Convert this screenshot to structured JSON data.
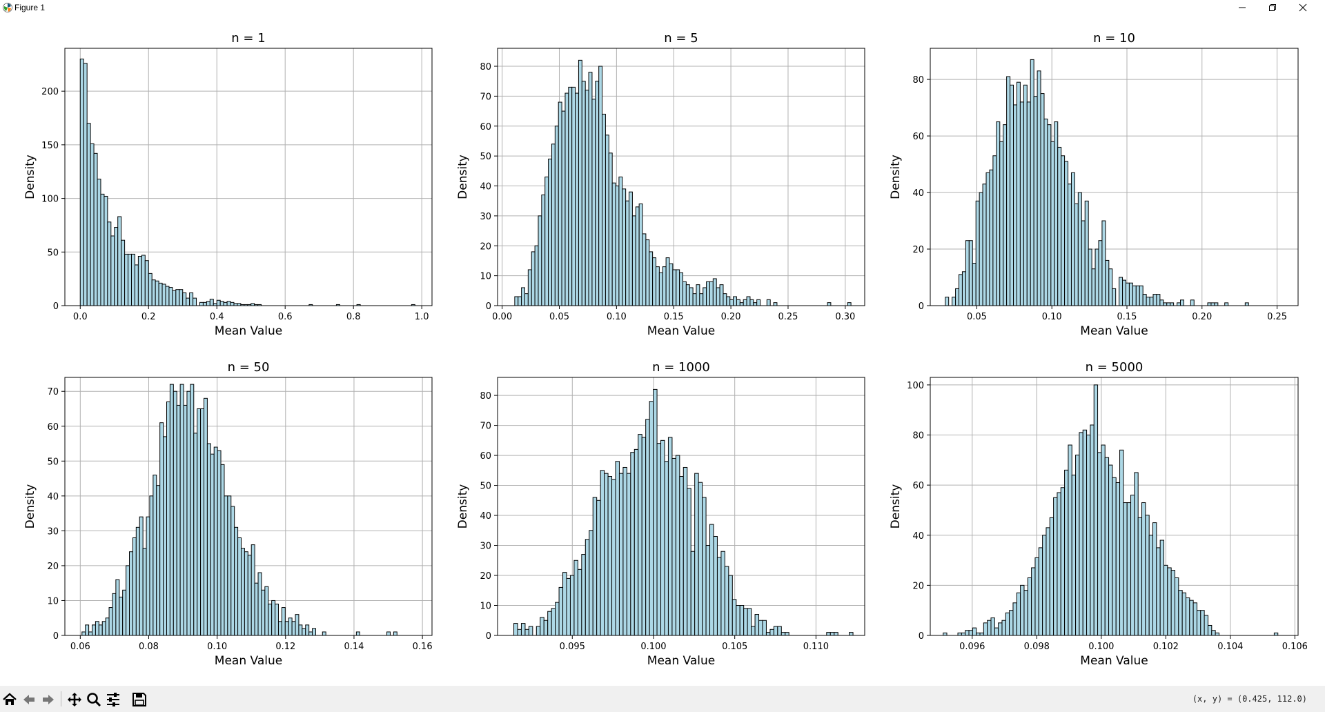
{
  "window": {
    "title": "Figure 1"
  },
  "toolbar": {
    "tools": [
      "home-icon",
      "back-icon",
      "forward-icon",
      "pan-icon",
      "zoom-icon",
      "configure-subplots-icon",
      "save-icon"
    ],
    "coords": "(x, y) = (0.425, 112.0)"
  },
  "style": {
    "bar_fill": "#add8e6",
    "bar_edge": "#000000",
    "grid": "#b0b0b0"
  },
  "chart_data": [
    {
      "type": "bar",
      "title": "n = 1",
      "xlabel": "Mean Value",
      "ylabel": "Density",
      "xlim": [
        -0.045,
        1.03
      ],
      "ylim": [
        0,
        240
      ],
      "grid": true,
      "xticks": [
        0.0,
        0.2,
        0.4,
        0.6,
        0.8,
        1.0
      ],
      "xtick_labels": [
        "0.0",
        "0.2",
        "0.4",
        "0.6",
        "0.8",
        "1.0"
      ],
      "yticks": [
        0,
        50,
        100,
        150,
        200
      ],
      "yticks_labels": [
        "0",
        "50",
        "100",
        "150",
        "200"
      ],
      "bin_start": 0.0,
      "bin_width": 0.01,
      "values": [
        230,
        226,
        170,
        151,
        142,
        118,
        104,
        102,
        78,
        65,
        73,
        83,
        61,
        48,
        48,
        48,
        38,
        46,
        47,
        42,
        30,
        24,
        23,
        21,
        20,
        18,
        17,
        14,
        15,
        15,
        12,
        7,
        12,
        7,
        0,
        3,
        3,
        4,
        6,
        2,
        5,
        4,
        3,
        4,
        3,
        2,
        2,
        1,
        1,
        1,
        2,
        1,
        1,
        0,
        0,
        0,
        0,
        0,
        0,
        0,
        0,
        0,
        0,
        0,
        0,
        0,
        0,
        1,
        0,
        0,
        0,
        0,
        0,
        0,
        0,
        1,
        0,
        0,
        0,
        0,
        0,
        1,
        0,
        0,
        0,
        0,
        0,
        0,
        0,
        0,
        0,
        0,
        0,
        0,
        0,
        0,
        0,
        1,
        0,
        0
      ]
    },
    {
      "type": "bar",
      "title": "n = 5",
      "xlabel": "Mean Value",
      "ylabel": "Density",
      "xlim": [
        -0.004,
        0.317
      ],
      "ylim": [
        0,
        86
      ],
      "grid": true,
      "xticks": [
        0.0,
        0.05,
        0.1,
        0.15,
        0.2,
        0.25,
        0.3
      ],
      "xtick_labels": [
        "0.00",
        "0.05",
        "0.10",
        "0.15",
        "0.20",
        "0.25",
        "0.30"
      ],
      "yticks": [
        0,
        10,
        20,
        30,
        40,
        50,
        60,
        70,
        80
      ],
      "yticks_labels": [
        "0",
        "10",
        "20",
        "30",
        "40",
        "50",
        "60",
        "70",
        "80"
      ],
      "bin_start": 0.011,
      "bin_width": 0.00294,
      "values": [
        3,
        3,
        6,
        4,
        12,
        18,
        20,
        30,
        37,
        43,
        49,
        54,
        60,
        68,
        65,
        71,
        73,
        73,
        71,
        82,
        75,
        72,
        78,
        69,
        75,
        80,
        64,
        57,
        51,
        41,
        40,
        43,
        39,
        35,
        38,
        30,
        33,
        34,
        24,
        22,
        18,
        16,
        13,
        11,
        13,
        16,
        14,
        12,
        12,
        11,
        8,
        7,
        6,
        4,
        7,
        4,
        6,
        8,
        8,
        9,
        6,
        7,
        4,
        3,
        2,
        3,
        2,
        1,
        2,
        3,
        2,
        1,
        2,
        0,
        0,
        2,
        0,
        1,
        0,
        0,
        0,
        0,
        0,
        0,
        0,
        0,
        0,
        0,
        0,
        0,
        0,
        0,
        0,
        1,
        0,
        0,
        0,
        0,
        0,
        1
      ]
    },
    {
      "type": "bar",
      "title": "n = 10",
      "xlabel": "Mean Value",
      "ylabel": "Density",
      "xlim": [
        0.019,
        0.264
      ],
      "ylim": [
        0,
        91
      ],
      "grid": true,
      "xticks": [
        0.05,
        0.1,
        0.15,
        0.2,
        0.25
      ],
      "xtick_labels": [
        "0.05",
        "0.10",
        "0.15",
        "0.20",
        "0.25"
      ],
      "yticks": [
        0,
        20,
        40,
        60,
        80
      ],
      "yticks_labels": [
        "0",
        "20",
        "40",
        "60",
        "80"
      ],
      "bin_start": 0.029,
      "bin_width": 0.00227,
      "values": [
        3,
        0,
        3,
        6,
        11,
        12,
        23,
        23,
        15,
        37,
        40,
        43,
        47,
        48,
        53,
        65,
        58,
        64,
        81,
        78,
        71,
        79,
        72,
        78,
        72,
        87,
        74,
        83,
        75,
        66,
        64,
        58,
        65,
        56,
        53,
        51,
        43,
        47,
        36,
        40,
        30,
        37,
        20,
        13,
        20,
        23,
        30,
        16,
        13,
        6,
        0,
        10,
        9,
        8,
        8,
        7,
        7,
        7,
        4,
        3,
        3,
        4,
        4,
        2,
        1,
        1,
        1,
        0,
        1,
        2,
        0,
        0,
        2,
        0,
        0,
        0,
        0,
        1,
        1,
        1,
        0,
        0,
        1,
        0,
        0,
        0,
        0,
        0,
        1,
        0
      ]
    },
    {
      "type": "bar",
      "title": "n = 50",
      "xlabel": "Mean Value",
      "ylabel": "Density",
      "xlim": [
        0.0555,
        0.1628
      ],
      "ylim": [
        0,
        74
      ],
      "grid": true,
      "xticks": [
        0.06,
        0.08,
        0.1,
        0.12,
        0.14,
        0.16
      ],
      "xtick_labels": [
        "0.06",
        "0.08",
        "0.10",
        "0.12",
        "0.14",
        "0.16"
      ],
      "yticks": [
        0,
        10,
        20,
        30,
        40,
        50,
        60,
        70
      ],
      "yticks_labels": [
        "0",
        "10",
        "20",
        "30",
        "40",
        "50",
        "60",
        "70"
      ],
      "bin_start": 0.0605,
      "bin_width": 0.00099,
      "values": [
        1,
        3,
        1,
        3,
        4,
        3,
        4,
        5,
        8,
        12,
        16,
        11,
        13,
        20,
        24,
        28,
        31,
        34,
        25,
        34,
        40,
        46,
        43,
        61,
        57,
        67,
        72,
        70,
        66,
        72,
        66,
        70,
        72,
        58,
        65,
        65,
        68,
        55,
        52,
        54,
        53,
        49,
        40,
        40,
        37,
        31,
        28,
        25,
        24,
        23,
        26,
        15,
        18,
        13,
        14,
        9,
        10,
        9,
        4,
        8,
        4,
        5,
        4,
        6,
        3,
        2,
        3,
        1,
        2,
        0,
        0,
        1,
        0,
        0,
        0,
        0,
        0,
        0,
        0,
        0,
        0,
        1,
        0,
        0,
        0,
        0,
        0,
        0,
        0,
        0,
        1,
        0,
        1
      ]
    },
    {
      "type": "bar",
      "title": "n = 1000",
      "xlabel": "Mean Value",
      "ylabel": "Density",
      "xlim": [
        0.0904,
        0.113
      ],
      "ylim": [
        0,
        86
      ],
      "grid": true,
      "xticks": [
        0.095,
        0.1,
        0.105,
        0.11
      ],
      "xtick_labels": [
        "0.095",
        "0.100",
        "0.105",
        "0.110"
      ],
      "yticks": [
        0,
        10,
        20,
        30,
        40,
        50,
        60,
        70,
        80
      ],
      "yticks_labels": [
        "0",
        "10",
        "20",
        "30",
        "40",
        "50",
        "60",
        "70",
        "80"
      ],
      "bin_start": 0.0914,
      "bin_width": 0.000232,
      "values": [
        4,
        2,
        4,
        2,
        3,
        0,
        3,
        6,
        5,
        8,
        9,
        11,
        16,
        21,
        19,
        20,
        25,
        22,
        27,
        32,
        35,
        46,
        45,
        55,
        54,
        53,
        52,
        58,
        54,
        56,
        54,
        61,
        62,
        67,
        66,
        72,
        78,
        82,
        64,
        65,
        58,
        66,
        59,
        60,
        53,
        56,
        49,
        28,
        54,
        51,
        46,
        30,
        37,
        33,
        26,
        28,
        23,
        20,
        12,
        10,
        10,
        9,
        9,
        3,
        7,
        5,
        5,
        1,
        2,
        3,
        3,
        1,
        1,
        0,
        0,
        0,
        0,
        0,
        0,
        0,
        0,
        0,
        0,
        1,
        1,
        1,
        0,
        0,
        0,
        1,
        0,
        0,
        0
      ]
    },
    {
      "type": "bar",
      "title": "n = 5000",
      "xlabel": "Mean Value",
      "ylabel": "Density",
      "xlim": [
        0.0947,
        0.1061
      ],
      "ylim": [
        0,
        103
      ],
      "grid": true,
      "xticks": [
        0.096,
        0.098,
        0.1,
        0.102,
        0.104,
        0.106
      ],
      "xtick_labels": [
        "0.096",
        "0.098",
        "0.100",
        "0.102",
        "0.104",
        "0.106"
      ],
      "yticks": [
        0,
        20,
        40,
        60,
        80,
        100
      ],
      "yticks_labels": [
        "0",
        "20",
        "40",
        "60",
        "80",
        "100"
      ],
      "bin_start": 0.0951,
      "bin_width": 0.000114,
      "values": [
        1,
        0,
        0,
        0,
        1,
        1,
        2,
        2,
        3,
        1,
        1,
        5,
        6,
        7,
        3,
        5,
        6,
        9,
        10,
        13,
        17,
        20,
        18,
        23,
        27,
        31,
        35,
        40,
        43,
        47,
        55,
        57,
        59,
        66,
        76,
        64,
        72,
        81,
        82,
        80,
        84,
        100,
        73,
        76,
        71,
        68,
        63,
        61,
        74,
        53,
        53,
        56,
        65,
        47,
        53,
        48,
        40,
        45,
        35,
        38,
        28,
        27,
        26,
        23,
        18,
        17,
        15,
        14,
        13,
        10,
        10,
        8,
        4,
        2,
        1,
        0,
        0,
        0,
        0,
        0,
        0,
        0,
        0,
        0,
        0,
        0,
        0,
        0,
        0,
        0,
        1,
        0,
        0
      ]
    }
  ]
}
